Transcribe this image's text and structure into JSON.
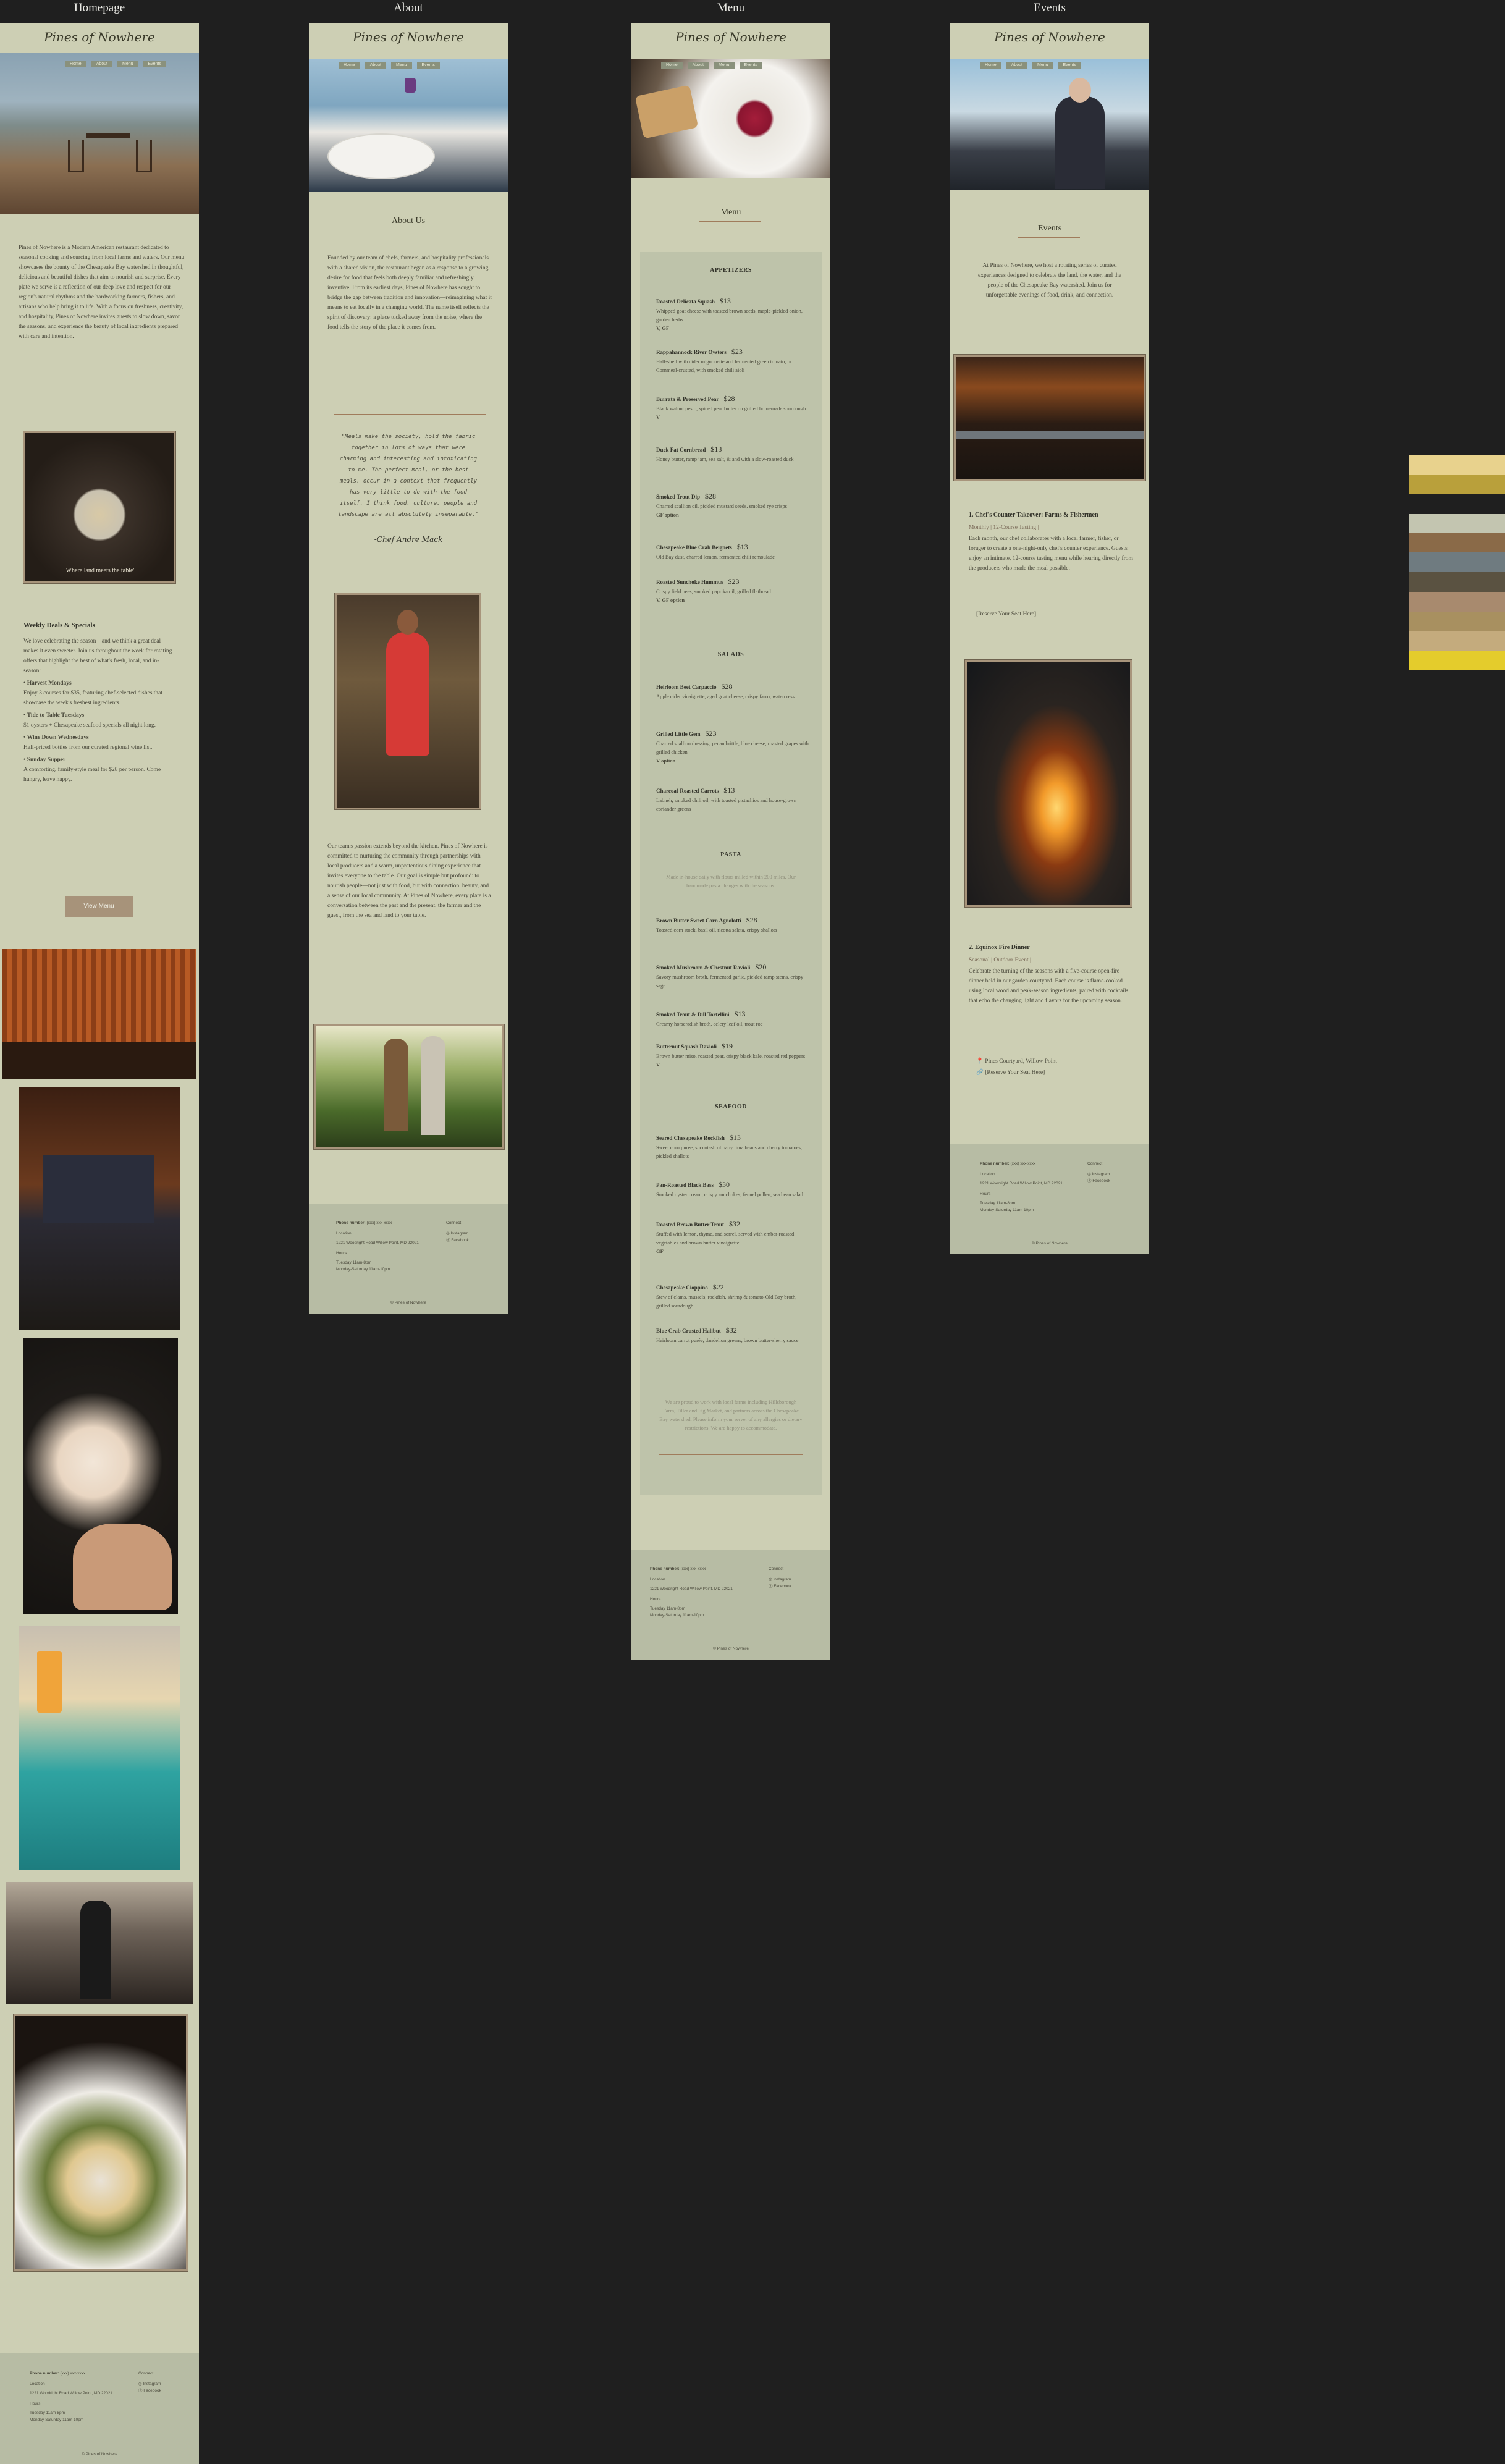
{
  "column_titles": [
    "Homepage",
    "About",
    "Menu",
    "Events"
  ],
  "brand": "Pines of Nowhere",
  "nav": [
    "Home",
    "About",
    "Menu",
    "Events"
  ],
  "home": {
    "intro": "Pines of Nowhere is a Modern American restaurant dedicated to seasonal cooking and sourcing from local farms and waters. Our menu showcases the bounty of the Chesapeake Bay watershed in thoughtful, delicious and beautiful dishes that aim to nourish and surprise. Every plate we serve is a reflection of our deep love and respect for our region's natural rhythms and the hardworking farmers, fishers, and artisans who help bring it to life. With a focus on freshness, creativity, and hospitality, Pines of Nowhere invites guests to slow down, savor the seasons, and experience the beauty of local ingredients prepared with care and intention.",
    "caption": "\"Where land meets the table\"",
    "weekly_title": "Weekly Deals & Specials",
    "weekly_intro": "We love celebrating the season—and we think a great deal makes it even sweeter. Join us throughout the week for rotating offers that highlight the best of what's fresh, local, and in-season:",
    "deals": [
      {
        "name": "Harvest Mondays",
        "desc": "Enjoy 3 courses for $35, featuring chef-selected dishes that showcase the week's freshest ingredients."
      },
      {
        "name": "Tide to Table Tuesdays",
        "desc": "$1 oysters + Chesapeake seafood specials all night long."
      },
      {
        "name": "Wine Down Wednesdays",
        "desc": "Half-priced bottles from our curated regional wine list."
      },
      {
        "name": "Sunday Supper",
        "desc": "A comforting, family-style meal for $28 per person. Come hungry, leave happy."
      }
    ],
    "button": "View Menu"
  },
  "about": {
    "title": "About Us",
    "p1": "Founded by our team of chefs, farmers, and hospitality professionals with a shared vision, the restaurant began as a response to a growing desire for food that feels both deeply familiar and refreshingly inventive. From its earliest days, Pines of Nowhere has sought to bridge the gap between tradition and innovation—reimagining what it means to eat locally in a changing world. The name itself reflects the spirit of discovery: a place tucked away from the noise, where the food tells the story of the place it comes from.",
    "quote": "\"Meals make the society, hold the fabric together in lots of ways that were charming and interesting and intoxicating to me. The perfect meal, or the best meals, occur in a context that frequently has very little to do with the food itself. I think food, culture, people and landscape are all absolutely inseparable.\"",
    "quote_author": "-Chef Andre Mack",
    "p2": "Our team's passion extends beyond the kitchen. Pines of Nowhere is committed to nurturing the community through partnerships with local producers and a warm, unpretentious dining experience that invites everyone to the table. Our goal is simple but profound: to nourish people—not just with food, but with connection, beauty, and a sense of our local community. At Pines of Nowhere, every plate is a conversation between the past and the present, the farmer and the guest, from the sea and land to your table."
  },
  "menu": {
    "title": "Menu",
    "categories": [
      {
        "name": "APPETIZERS",
        "items": [
          {
            "name": "Roasted Delicata Squash",
            "price": "$13",
            "desc": "Whipped goat cheese with toasted brown seeds, maple-pickled onion, garden herbs",
            "tag": "V, GF"
          },
          {
            "name": "Rappahannock River Oysters",
            "price": "$23",
            "desc": "Half-shell with cider mignonette and fermented green tomato, or Cornmeal-crusted, with smoked chili aioli",
            "tag": ""
          },
          {
            "name": "Burrata & Preserved Pear",
            "price": "$28",
            "desc": "Black walnut pesto, spiced pear butter on grilled homemade sourdough",
            "tag": "V"
          },
          {
            "name": "Duck Fat Cornbread",
            "price": "$13",
            "desc": "Honey butter, ramp jam, sea salt, & and with a slow-roasted duck",
            "tag": ""
          },
          {
            "name": "Smoked Trout Dip",
            "price": "$28",
            "desc": "Charred scallion oil, pickled mustard seeds, smoked rye crisps",
            "tag": "GF option"
          },
          {
            "name": "Chesapeake Blue Crab Beignets",
            "price": "$13",
            "desc": "Old Bay dust, charred lemon, fermented chili remoulade",
            "tag": ""
          },
          {
            "name": "Roasted Sunchoke Hummus",
            "price": "$23",
            "desc": "Crispy field peas, smoked paprika oil, grilled flatbread",
            "tag": "V, GF option"
          }
        ]
      },
      {
        "name": "SALADS",
        "items": [
          {
            "name": "Heirloom Beet Carpaccio",
            "price": "$28",
            "desc": "Apple cider vinaigrette, aged goat cheese, crispy farro, watercress",
            "tag": ""
          },
          {
            "name": "Grilled Little Gem",
            "price": "$23",
            "desc": "Charred scallion dressing, pecan brittle, blue cheese, roasted grapes with grilled chicken",
            "tag": "V option"
          },
          {
            "name": "Charcoal-Roasted Carrots",
            "price": "$13",
            "desc": "Labneh, smoked chili oil, with toasted pistachios and house-grown coriander greens",
            "tag": ""
          }
        ]
      },
      {
        "name": "PASTA",
        "note": "Made in-house daily with flours milled within 200 miles. Our handmade pasta changes with the seasons.",
        "items": [
          {
            "name": "Brown Butter Sweet Corn Agnolotti",
            "price": "$28",
            "desc": "Toasted corn stock, basil oil, ricotta salata, crispy shallots",
            "tag": ""
          },
          {
            "name": "Smoked Mushroom & Chestnut Ravioli",
            "price": "$20",
            "desc": "Savory mushroom broth, fermented garlic, pickled ramp stems, crispy sage",
            "tag": ""
          },
          {
            "name": "Smoked Trout & Dill Tortellini",
            "price": "$13",
            "desc": "Creamy horseradish broth, celery leaf oil, trout roe",
            "tag": ""
          },
          {
            "name": "Butternut Squash Ravioli",
            "price": "$19",
            "desc": "Brown butter miso, roasted pear, crispy black kale, roasted red peppers",
            "tag": "V"
          }
        ]
      },
      {
        "name": "SEAFOOD",
        "items": [
          {
            "name": "Seared Chesapeake Rockfish",
            "price": "$13",
            "desc": "Sweet corn purée, succotash of baby lima beans and cherry tomatoes, pickled shallots",
            "tag": ""
          },
          {
            "name": "Pan-Roasted Black Bass",
            "price": "$30",
            "desc": "Smoked oyster cream, crispy sunchokes, fennel pollen, sea bean salad",
            "tag": ""
          },
          {
            "name": "Roasted Brown Butter Trout",
            "price": "$32",
            "desc": "Stuffed with lemon, thyme, and sorrel, served with ember-roasted vegetables and brown butter vinaigrette",
            "tag": "GF"
          },
          {
            "name": "Chesapeake Cioppino",
            "price": "$22",
            "desc": "Stew of clams, mussels, rockfish, shrimp & tomato-Old Bay broth, grilled sourdough",
            "tag": ""
          },
          {
            "name": "Blue Crab Crusted Halibut",
            "price": "$32",
            "desc": "Heirloom carrot purée, dandelion greens, brown butter-sherry sauce",
            "tag": ""
          }
        ]
      }
    ],
    "closing_note": "We are proud to work with local farms including Hillsborough Farm, Tiller and Fig Market, and partners across the Chesapeake Bay watershed. Please inform your server of any allergies or dietary restrictions. We are happy to accommodate."
  },
  "events": {
    "title": "Events",
    "intro": "At Pines of Nowhere, we host a rotating series of curated experiences designed to celebrate the land, the water, and the people of the Chesapeake Bay watershed. Join us for unforgettable evenings of food, drink, and connection.",
    "event1": {
      "title": "1. Chef's Counter Takeover: Farms & Fishermen",
      "sub": "Monthly | 12-Course Tasting |",
      "desc": "Each month, our chef collaborates with a local farmer, fisher, or forager to create a one-night-only chef's counter experience. Guests enjoy an intimate, 12-course tasting menu while hearing directly from the producers who made the meal possible.",
      "link": "[Reserve Your Seat Here]"
    },
    "event2": {
      "title": "2. Equinox Fire Dinner",
      "sub": "Seasonal | Outdoor Event |",
      "desc": "Celebrate the turning of the seasons with a five-course open-fire dinner held in our garden courtyard. Each course is flame-cooked using local wood and peak-season ingredients, paired with cocktails that echo the changing light and flavors for the upcoming season.",
      "location": "Pines Courtyard, Willow Point",
      "link": "[Reserve Your Seat Here]"
    }
  },
  "footer": {
    "phone_label": "Phone number:",
    "phone": "(xxx) xxx-xxxx",
    "location_label": "Location",
    "address": "1221 Woodright Road Willow Point, MD 22021",
    "hours_label": "Hours",
    "hours1": "Tuesday 11am-8pm",
    "hours2": "Monday-Saturday 11am-10pm",
    "connect_label": "Connect",
    "social1": "Instagram",
    "social2": "Facebook",
    "copyright": "© Pines of Nowhere"
  },
  "palette": [
    "#e8d28d",
    "#b9a03b",
    "#1f1f1f",
    "#c3c5b0",
    "#8a6a48",
    "#6f7b80",
    "#5a5241",
    "#a88a6e",
    "#a89060",
    "#c4ab7d",
    "#e4cc2c"
  ]
}
